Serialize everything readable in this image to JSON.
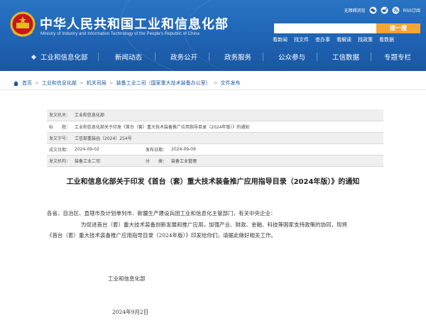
{
  "header": {
    "site_title": "中华人民共和国工业和信息化部",
    "site_subtitle": "Ministry of Industry and Information Technology of the People's Republic of China",
    "top_links": [
      {
        "label": "无障碍浏览",
        "icon": "accessibility-icon"
      },
      {
        "label": "",
        "icon": "wechat-icon"
      },
      {
        "label": "",
        "icon": "weibo-icon"
      },
      {
        "label": "RSS订阅",
        "icon": "rss-icon"
      }
    ],
    "search_placeholder": "",
    "search_button": "搜一搜",
    "quick_links": [
      "看新闻",
      "找文件",
      "查办事",
      "看解读",
      "找政策",
      "看数据"
    ]
  },
  "nav": {
    "items": [
      "工业和信息化部",
      "新闻动态",
      "政务公开",
      "政务服务",
      "公众参与",
      "工信数据",
      "专题专栏"
    ]
  },
  "breadcrumb": {
    "items": [
      "首页",
      "工业和信息化部",
      "机关司局",
      "装备工业二司（国家重大技术装备办公室）",
      "文件发布"
    ]
  },
  "meta": {
    "issuer_label": "发文机关：",
    "issuer": "工业和信息化部",
    "title_label": "标　　题：",
    "title": "工业和信息化部关于印发《首台（套）重大技术装备推广应用指导目录（2024年版）》的通知",
    "doc_no_label": "发文字号：",
    "doc_no": "工信部重装函〔2024〕254号",
    "written_date_label": "成文日期：",
    "written_date": "2024-09-02",
    "publish_date_label": "发布日期：",
    "publish_date": "2024-09-09",
    "dept_label": "发文机构：",
    "dept": "装备工业二司",
    "category_label": "分　　类：",
    "category": "装备工业管理"
  },
  "article": {
    "title": "工业和信息化部关于印发《首台（套）重大技术装备推广应用指导目录（2024年版）》的通知",
    "recipients": "各省、自治区、直辖市及计划单列市、新疆生产建设兵团工业和信息化主管部门，有关中央企业：",
    "para1_line1": "为促进首台（套）重大技术装备创新发展和推广应用，加强产业、财政、金融、科技等国家支持政策的协同，现将",
    "para1_line2": "《首台（套）重大技术装备推广应用指导目录（2024年版）》印发给你们，请据此做好相关工作。",
    "signature": "工业和信息化部",
    "date": "2024年9月2日"
  },
  "colors": {
    "header_blue": "#1f63b3",
    "search_button": "#f4a533",
    "link_blue": "#1a56a0"
  }
}
